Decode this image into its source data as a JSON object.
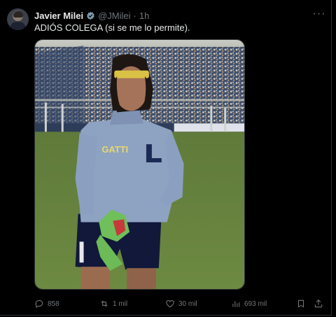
{
  "post": {
    "author_name": "Javier Milei",
    "handle": "@JMilei",
    "separator": "·",
    "time": "1h",
    "text": "ADIÓS COLEGA (si se me lo permite).",
    "more_label": "···"
  },
  "media": {
    "jersey_lettering": "GATTI"
  },
  "actions": {
    "replies": "858",
    "reposts": "1 mil",
    "likes": "30 mil",
    "views": "693 mil"
  },
  "icons": [
    "avatar",
    "verified-badge-icon",
    "more-icon",
    "reply-icon",
    "repost-icon",
    "like-icon",
    "views-icon",
    "bookmark-icon",
    "share-icon"
  ],
  "colors": {
    "background": "#000000",
    "text": "#e7e9ea",
    "muted": "#71767b",
    "verified": "#829aab"
  }
}
